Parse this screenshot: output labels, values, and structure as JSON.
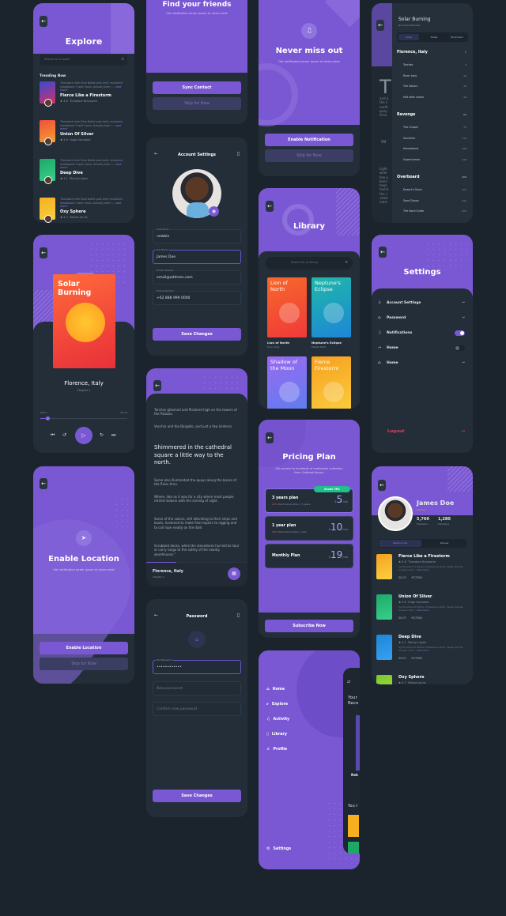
{
  "colors": {
    "accent": "#7a58d3",
    "background": "#1b242d",
    "card": "#232e39",
    "badge": "#1fc08a",
    "logout": "#e0425a"
  },
  "explore": {
    "title": "Explore",
    "search_placeholder": "Search for a book?",
    "section": "Trending Now",
    "books": [
      {
        "title": "Fierce Like a Firestorm",
        "rating": "4.8",
        "author": "Theodore Bramante",
        "desc": "\"Bushwick meh Blue Bottle pork belly mustache skateboard 3 wolf moon. Actually beer l...",
        "more": "read more\"",
        "cover": "linear-gradient(160deg,#3b4ad0,#d0306a)"
      },
      {
        "title": "Union Of Silver",
        "rating": "4.6",
        "author": "Hugo Gonzalez",
        "desc": "\"Bushwick meh Blue Bottle pork belly mustache skateboard 3 wolf moon. Actually beer l...",
        "more": "read more\"",
        "cover": "linear-gradient(160deg,#f0503a,#f5a030)"
      },
      {
        "title": "Deep Dive",
        "rating": "4.1",
        "author": "Marilyn Agler",
        "desc": "\"Bushwick meh Blue Bottle pork belly mustache skateboard 3 wolf moon. Actually beer l...",
        "more": "read more\"",
        "cover": "linear-gradient(160deg,#1ea868,#38d08a)"
      },
      {
        "title": "Oxy Sphere",
        "rating": "4.7",
        "author": "Nelson Jarvis",
        "desc": "\"Bushwick meh Blue Bottle pork belly mustache skateboard 3 wolf moon. Actually beer l...",
        "more": "read more\"",
        "cover": "linear-gradient(160deg,#f5b020,#f8d040)"
      }
    ]
  },
  "friends": {
    "title": "Find your friends",
    "subtitle": "Get notification lorem ipsum sir dolor amet",
    "primary": "Sync Contact",
    "skip": "Skip for Now"
  },
  "notify": {
    "title": "Never miss out",
    "subtitle": "Get notification lorem ipsum sir dolor amet",
    "primary": "Enable Notification",
    "skip": "Skip for Now"
  },
  "toc": {
    "book": "Solar Burning",
    "author": "Nicholas Bobowski",
    "tabs": [
      "Index",
      "Notes",
      "Bookmark"
    ],
    "big_letter": "T",
    "peek_text": "and p the c north quay Arno",
    "peek_quote": "99",
    "peek_text2": "Light wher few p been town had b the c same mast",
    "items": [
      {
        "label": "Florence, Italy",
        "page": "1",
        "h": true
      },
      {
        "label": "Torches",
        "page": "5"
      },
      {
        "label": "River Arno",
        "page": "16"
      },
      {
        "label": "The Sailors",
        "page": "32"
      },
      {
        "label": "Hell after words",
        "page": "44"
      },
      {
        "label": "Revenge",
        "page": "89",
        "h": true
      },
      {
        "label": "The Chapel",
        "page": "72"
      },
      {
        "label": "Sunshine",
        "page": "114"
      },
      {
        "label": "Homestand",
        "page": "128"
      },
      {
        "label": "Superhuman",
        "page": "144"
      },
      {
        "label": "Overboard",
        "page": "200",
        "h": true
      },
      {
        "label": "Desert's Oasis",
        "page": "207"
      },
      {
        "label": "Sand Dunes",
        "page": "231"
      },
      {
        "label": "The Sand Surfer",
        "page": "250"
      }
    ]
  },
  "account": {
    "title": "Account Settings",
    "fields": [
      {
        "label": "Username",
        "value": "newbie"
      },
      {
        "label": "Full Name",
        "value": "James Doe"
      },
      {
        "label": "Email Address",
        "value": "email@address.com"
      },
      {
        "label": "Phone Number",
        "value": "+62 888 999 0000"
      }
    ],
    "save": "Save Changes"
  },
  "library": {
    "title": "Library",
    "search_placeholder": "Search for in library",
    "books": [
      {
        "cover_title": "Lion of North",
        "title": "Lion of North",
        "author": "Tony Song",
        "cover": "linear-gradient(160deg,#f7682a,#ef3a3a)"
      },
      {
        "cover_title": "Neptune's Eclipse",
        "title": "Neptune's Eclipse",
        "author": "Maeda Rosh",
        "cover": "linear-gradient(160deg,#1fb8a8,#1e86d8)"
      },
      {
        "cover_title": "Shadow of the Moon",
        "cover": "linear-gradient(160deg,#9a6af0,#5a7ef0)"
      },
      {
        "cover_title": "Fierce Firestorm",
        "cover": "linear-gradient(160deg,#f7a020,#fbd040)"
      }
    ]
  },
  "player": {
    "book_title": "Solar Burning",
    "place": "Florence, Italy",
    "chapter": "Chapter 1",
    "elapsed": "00:11",
    "total": "59:11",
    "progress": 0.08
  },
  "reader": {
    "p1": "Torches gleamed and flickered high on the towers of the Palazzo.",
    "p2": "Vecchio and the Bargello, and just a few lanterns",
    "heading": "Shimmered in the cathedral square a little way to the north.",
    "p3": "Some also illuminated the quays along the banks of the River Arno.",
    "p4": "Where, late as it was for a city where most people retired indoors with the coming of night.",
    "p5": "Some of the sailors, still attending to their ships and boats, hastened to make final repairs to rigging and to coil rope neatly on the dark",
    "p6": "Scrubbed decks, while the stevedores hurried to haul or carry cargo to the safety of the nearby warehouses.\"",
    "footer_title": "Florence, Italy",
    "footer_sub": "Chapter 1",
    "progress": 0.3
  },
  "settings": {
    "title": "Settings",
    "items": [
      {
        "icon": "user",
        "label": "Account Settings",
        "control": "arrow"
      },
      {
        "icon": "lock",
        "label": "Password",
        "control": "arrow"
      },
      {
        "icon": "bell",
        "label": "Notifications",
        "control": "toggle",
        "on": true
      },
      {
        "icon": "arrow",
        "label": "Home",
        "control": "toggle",
        "on": false
      },
      {
        "icon": "bag",
        "label": "Home",
        "control": "arrow"
      }
    ],
    "logout": "Logout"
  },
  "location": {
    "title": "Enable Location",
    "subtitle": "Get notification lorem ipsum sir dolor amet",
    "primary": "Enable Location",
    "skip": "Skip for Now"
  },
  "pricing": {
    "title": "Pricing Plan",
    "subtitle": "Get access to hundreds of audiobook collection from Outbook library",
    "badge": "Saves 76%",
    "plans": [
      {
        "name": "3 years plan",
        "note_hl": "20%",
        "note": "Total Subscription / 3 years",
        "price": "5",
        "unit": "/mo",
        "selected": true
      },
      {
        "name": "1 year plan",
        "note_hl": "50%",
        "note": "Total Subscription / year",
        "price": "10",
        "unit": "/mo"
      },
      {
        "name": "Monthly Plan",
        "price": "19",
        "unit": "/mo"
      }
    ],
    "subscribe": "Subscribe Now"
  },
  "password": {
    "title": "Password",
    "fields": [
      {
        "label": "Old Password",
        "value": "••••••••••••"
      },
      {
        "placeholder": "New password"
      },
      {
        "placeholder": "Confirm new password"
      }
    ],
    "save": "Save Changes"
  },
  "menu": {
    "items": [
      {
        "icon": "⌂",
        "label": "Home"
      },
      {
        "icon": "⌕",
        "label": "Explore"
      },
      {
        "icon": "♫",
        "label": "Activity"
      },
      {
        "icon": "▯",
        "label": "Library"
      },
      {
        "icon": "♙",
        "label": "Profile"
      }
    ],
    "settings": {
      "icon": "⚙",
      "label": "Settings"
    },
    "peek": {
      "line1": "Your",
      "line2": "Reco",
      "book": "Neb",
      "line3": "You r"
    }
  },
  "profile": {
    "name": "James Doe",
    "role": "Narrator",
    "followers": "5,760",
    "followers_label": "Followers",
    "following": "1,280",
    "following_label": "Following",
    "tabs": [
      "Reading List",
      "Review"
    ],
    "tags": "SCI-FI FICTION",
    "books": [
      {
        "title": "Fierce Like a Firestorm",
        "rating": "4.8",
        "author": "Theodore Bramante",
        "desc": "Synth polaroid bitters chillwave pickled. Vegan disrupt tousled. Port...",
        "more": "read more",
        "cover": "linear-gradient(160deg,#f7a020,#fbd040)"
      },
      {
        "title": "Union Of Silver",
        "rating": "4.6",
        "author": "Hugo Gonzalez",
        "desc": "Synth polaroid bitters chillwave pickled. Vegan disrupt tousled. Port...",
        "more": "read more",
        "cover": "linear-gradient(160deg,#1ea868,#38d08a)"
      },
      {
        "title": "Deep Dive",
        "rating": "4.1",
        "author": "Marilyn Agler",
        "desc": "Synth polaroid bitters chillwave pickled. Vegan disrupt tousled. Port...",
        "more": "read more",
        "cover": "linear-gradient(160deg,#1e86d8,#38a0f0)"
      },
      {
        "title": "Oxy Sphere",
        "rating": "4.7",
        "author": "Nelson Jarvis",
        "cover": "linear-gradient(160deg,#7ac830,#b0e040)"
      }
    ]
  }
}
